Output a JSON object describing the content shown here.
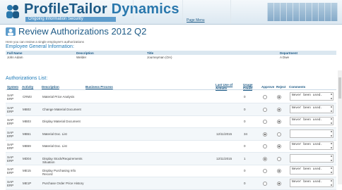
{
  "header": {
    "brand_main": "ProfileTailor",
    "brand_sub": "Dynamics",
    "tagline": "Ongoing Information Security",
    "page_menu": "Page Menu"
  },
  "page": {
    "title": "Review Authorizations 2012 Q2",
    "intro": "Here you can review a single employee's authorizations",
    "general_section": "Employee General Information:",
    "auth_section": "Authorizations List:"
  },
  "general": {
    "headers": [
      "Full Name",
      "Description",
      "Title",
      "Department"
    ],
    "values": [
      "John Adam",
      "Welder",
      "Journeyman (OA)",
      "A Dwe"
    ]
  },
  "auth_table": {
    "headers": {
      "system": "System",
      "activity": "Activity",
      "description": "Description",
      "business_process": "Business Process",
      "last_use": "Last Use of Activity",
      "usage": "Usage Count",
      "approve": "Approve",
      "reject": "Reject",
      "comments": "Comments"
    },
    "rows": [
      {
        "system": "SAP ERP",
        "activity": "CRM3",
        "description": "Material Price Analysis",
        "last_use": "",
        "usage": "0",
        "approve": false,
        "reject": true,
        "comment": "Never been used."
      },
      {
        "system": "SAP ERP",
        "activity": "MB02",
        "description": "Change Material Document",
        "last_use": "",
        "usage": "0",
        "approve": false,
        "reject": true,
        "comment": "Never been used."
      },
      {
        "system": "SAP ERP",
        "activity": "MB03",
        "description": "Display Material Document",
        "last_use": "",
        "usage": "0",
        "approve": false,
        "reject": true,
        "comment": "Never been used."
      },
      {
        "system": "SAP ERP",
        "activity": "MB51",
        "description": "Material Doc. List",
        "last_use": "12/11/2015",
        "usage": "34",
        "approve": true,
        "reject": false,
        "comment": ""
      },
      {
        "system": "SAP ERP",
        "activity": "MB59",
        "description": "Material Doc. List",
        "last_use": "",
        "usage": "0",
        "approve": false,
        "reject": true,
        "comment": "Never been used."
      },
      {
        "system": "SAP ERP",
        "activity": "MD04",
        "description": "Display Stock/Requirements Situation",
        "last_use": "12/11/2015",
        "usage": "1",
        "approve": true,
        "reject": false,
        "comment": ""
      },
      {
        "system": "SAP ERP",
        "activity": "ME15",
        "description": "Display Purchasing Info Record",
        "last_use": "",
        "usage": "0",
        "approve": false,
        "reject": true,
        "comment": "Never been used."
      },
      {
        "system": "SAP ERP",
        "activity": "ME1P",
        "description": "Purchase Order Price History",
        "last_use": "",
        "usage": "0",
        "approve": false,
        "reject": true,
        "comment": "Never been used."
      }
    ]
  },
  "colors": {
    "accent": "#1d5a86",
    "link": "#1d7ab8",
    "header_row": "#dbe7f0"
  }
}
